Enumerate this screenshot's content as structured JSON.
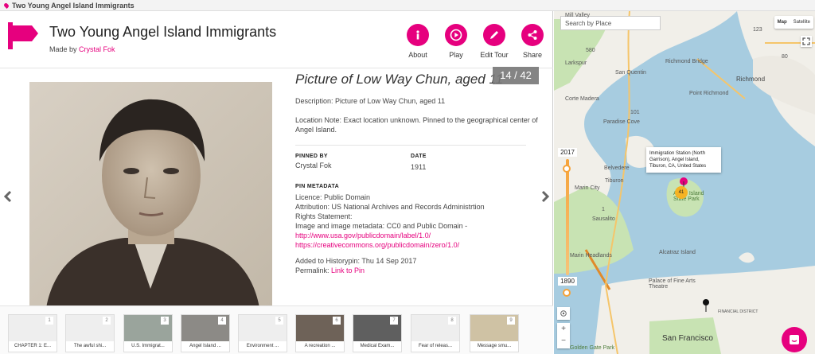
{
  "window": {
    "title": "Two Young Angel Island Immigrants"
  },
  "header": {
    "title": "Two Young Angel Island Immigrants",
    "made_by_prefix": "Made by",
    "author": "Crystal Fok",
    "actions": [
      {
        "label": "About",
        "icon": "info-icon"
      },
      {
        "label": "Play",
        "icon": "play-icon"
      },
      {
        "label": "Edit Tour",
        "icon": "pencil-icon"
      },
      {
        "label": "Share",
        "icon": "share-icon"
      }
    ],
    "accent": "#e6007e"
  },
  "pin": {
    "title": "Picture of Low Way Chun, aged 11",
    "counter": "14 / 42",
    "description": "Description: Picture of Low Way Chun, aged 11",
    "location_note": "Location Note: Exact location unknown. Pinned to the geographical center of Angel Island.",
    "pinned_by_label": "PINNED BY",
    "pinned_by": "Crystal Fok",
    "date_label": "DATE",
    "date": "1911",
    "metadata_label": "PIN METADATA",
    "licence": "Licence: Public Domain",
    "attribution": "Attribution: US National Archives and Records Administrtion",
    "rights": "Rights Statement:",
    "image_meta": "Image and image metadata: CC0 and Public Domain -",
    "link1": "http://www.usa.gov/publicdomain/label/1.0/",
    "link2": "https://creativecommons.org/publicdomain/zero/1.0/",
    "added": "Added to Historypin: Thu 14 Sep 2017",
    "permalink_prefix": "Permalink:",
    "permalink": "Link to Pin"
  },
  "strip": {
    "items": [
      {
        "num": "1",
        "label": "CHAPTER 1: E..."
      },
      {
        "num": "2",
        "label": "The awful shi..."
      },
      {
        "num": "3",
        "label": "U.S. Immigrat..."
      },
      {
        "num": "4",
        "label": "Angel Island ..."
      },
      {
        "num": "5",
        "label": "Environment ..."
      },
      {
        "num": "6",
        "label": "A recreation ..."
      },
      {
        "num": "7",
        "label": "Medical Exam..."
      },
      {
        "num": "8",
        "label": "Fear of releas..."
      },
      {
        "num": "9",
        "label": "Message smu..."
      }
    ]
  },
  "map": {
    "search_placeholder": "Search by Place",
    "type_map": "Map",
    "type_satellite": "Satellite",
    "slider_top": "2017",
    "slider_bottom": "1890",
    "tooltip": "Immigration Station (North Garrison), Angel Island, Tiburon, CA, United States",
    "cluster_count": "41",
    "zoom_in": "+",
    "zoom_out": "−",
    "places": {
      "richmond": "Richmond",
      "san_quentin": "San Quentin",
      "larkspur": "Larkspur",
      "corte_madera": "Corte Madera",
      "paradise_cove": "Paradise Cove",
      "belvedere": "Belvedere",
      "tiburon": "Tiburon",
      "sausalito": "Sausalito",
      "marin_city": "Marin City",
      "angel_island": "Angel Island State Park",
      "marin_headlands": "Marin Headlands",
      "alcatraz": "Alcatraz Island",
      "palace": "Palace of Fine Arts Theatre",
      "san_francisco": "San Francisco",
      "golden_gate_park": "Golden Gate Park",
      "financial": "FINANCIAL DISTRICT",
      "mill_valley": "Mill Valley",
      "richmond_bridge": "Richmond Bridge",
      "point_richmond": "Point Richmond",
      "hwy_580": "580",
      "hwy_101": "101",
      "hwy_80": "80",
      "hwy_1": "1",
      "hwy_131": "131",
      "hwy_123": "123"
    },
    "colors": {
      "water": "#a7cce0",
      "land": "#f1efe9",
      "park": "#c8e3b3"
    }
  }
}
